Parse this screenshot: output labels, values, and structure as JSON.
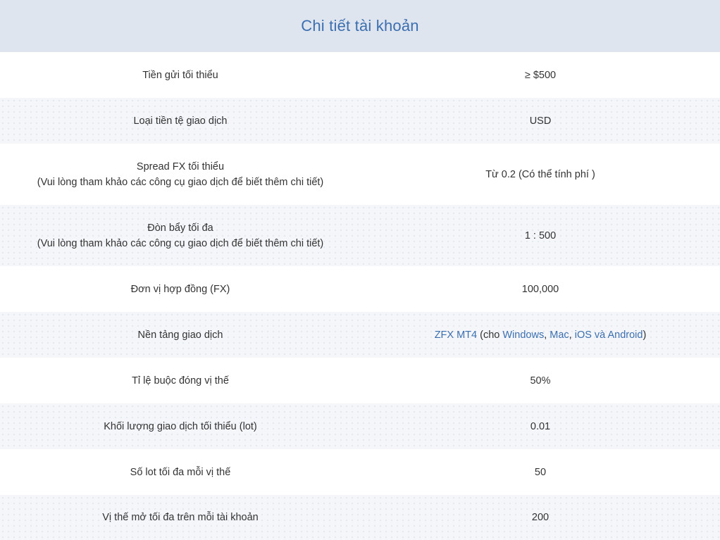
{
  "title": "Chi tiết tài khoản",
  "colors": {
    "accent": "#3c6fb0",
    "header_bg": "#dfe5ee",
    "alt_row_bg": "#f4f6f9"
  },
  "rows": [
    {
      "label": "Tiền gửi tối thiểu",
      "value": "≥ $500"
    },
    {
      "label": "Loại tiền tệ giao dịch",
      "value": "USD"
    },
    {
      "label": "Spread FX tối thiểu",
      "note": "(Vui lòng tham khảo các công cụ giao dịch để biết thêm chi tiết)",
      "value": "Từ 0.2 (Có thể tính phí )"
    },
    {
      "label": "Đòn bẩy tối đa",
      "note": "(Vui lòng tham khảo các công cụ giao dịch để biết thêm chi tiết)",
      "value": "1 : 500"
    },
    {
      "label": "Đơn vị hợp đồng (FX)",
      "value": "100,000"
    },
    {
      "label": "Nền tảng giao dịch",
      "platform": {
        "name": "ZFX MT4",
        "open": " (cho ",
        "windows": "Windows",
        "comma1": ", ",
        "mac": "Mac",
        "comma2": ", ",
        "ios_android": "iOS và Android",
        "close": ")"
      }
    },
    {
      "label": "Tỉ lệ buộc đóng vị thế",
      "value": "50%"
    },
    {
      "label": "Khối lượng giao dịch tối thiểu (lot)",
      "value": "0.01"
    },
    {
      "label": "Số lot tối đa mỗi vị thế",
      "value": "50"
    },
    {
      "label": "Vị thế mở tối đa trên mỗi tài khoản",
      "value": "200"
    }
  ]
}
